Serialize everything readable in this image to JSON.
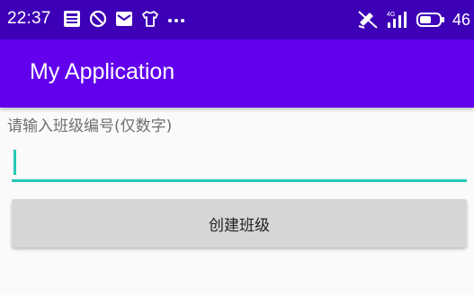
{
  "status_bar": {
    "time": "22:37",
    "left_icons": [
      "news-icon",
      "do-not-disturb-icon",
      "mail-icon",
      "shirt-icon",
      "more-dots-icon"
    ],
    "right_icons": [
      "mute-icon",
      "signal-4g-icon",
      "battery-icon"
    ],
    "battery_level": "46"
  },
  "app_bar": {
    "title": "My Application"
  },
  "form": {
    "hint": "请输入班级编号(仅数字)",
    "input_value": "",
    "create_button_label": "创建班级"
  },
  "colors": {
    "status_bar": "#3d00b6",
    "app_bar": "#6200ee",
    "accent": "#26c6b5",
    "button": "#d6d6d6"
  }
}
